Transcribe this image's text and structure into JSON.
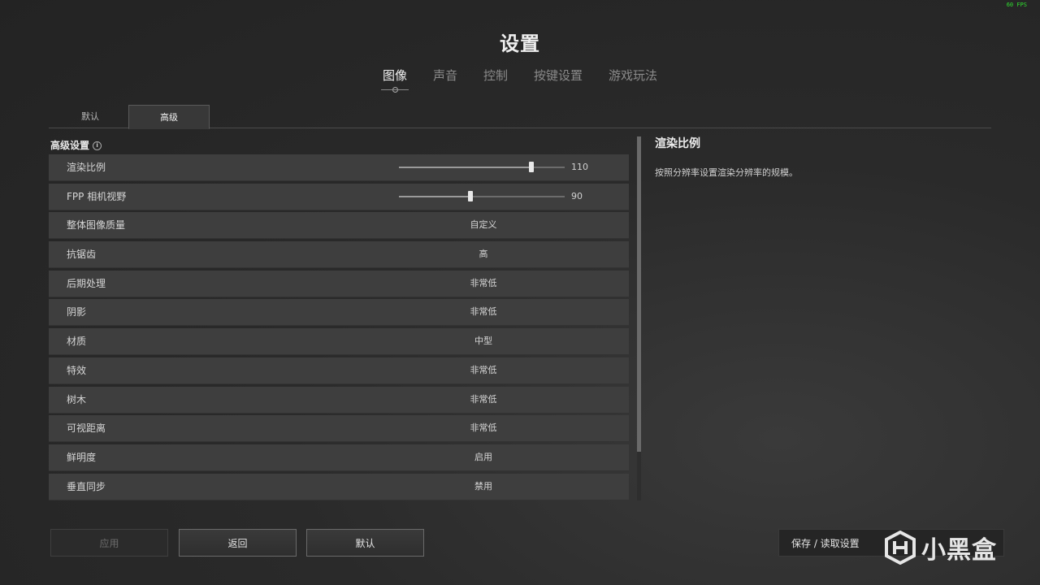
{
  "fps": "60 FPS",
  "title": "设置",
  "main_tabs": [
    "图像",
    "声音",
    "控制",
    "按键设置",
    "游戏玩法"
  ],
  "sub_tabs": [
    "默认",
    "高级"
  ],
  "section_title": "高级设置",
  "rows": [
    {
      "label": "渲染比例",
      "value": "110",
      "slider": 0.8
    },
    {
      "label": "FPP 相机视野",
      "value": "90",
      "slider": 0.43
    },
    {
      "label": "整体图像质量",
      "value": "自定义"
    },
    {
      "label": "抗锯齿",
      "value": "高"
    },
    {
      "label": "后期处理",
      "value": "非常低"
    },
    {
      "label": "阴影",
      "value": "非常低"
    },
    {
      "label": "材质",
      "value": "中型"
    },
    {
      "label": "特效",
      "value": "非常低"
    },
    {
      "label": "树木",
      "value": "非常低"
    },
    {
      "label": "可视距离",
      "value": "非常低"
    },
    {
      "label": "鲜明度",
      "value": "启用"
    },
    {
      "label": "垂直同步",
      "value": "禁用"
    }
  ],
  "description": {
    "title": "渲染比例",
    "text": "按照分辨率设置渲染分辨率的规模。"
  },
  "buttons": {
    "apply": "应用",
    "back": "返回",
    "default": "默认",
    "save_load": "保存 / 读取设置"
  },
  "watermark_text": "小黑盒",
  "colors": {
    "background": "#2a2a2a",
    "row": "#3e3e3e",
    "fps": "#2fe02f"
  }
}
